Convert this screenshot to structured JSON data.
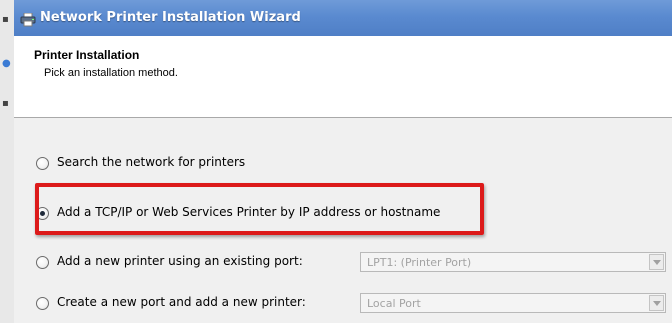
{
  "window": {
    "title": "Network Printer Installation Wizard",
    "icon": "printer-icon"
  },
  "header": {
    "title": "Printer Installation",
    "subtitle": "Pick an installation method."
  },
  "options": [
    {
      "label": "Search the network for printers",
      "selected": false
    },
    {
      "label": "Add a TCP/IP or Web Services Printer by IP address or hostname",
      "selected": true
    },
    {
      "label": "Add a new printer using an existing port:",
      "selected": false
    },
    {
      "label": "Create a new port and add a new printer:",
      "selected": false
    }
  ],
  "existing_port": {
    "value": "LPT1: (Printer Port)",
    "enabled": false
  },
  "new_port_type": {
    "value": "Local Port",
    "enabled": false
  },
  "colors": {
    "title_bar": "#5a8ad0",
    "highlight_box": "#dc1a1a",
    "dialog_body": "#f0f0f0"
  }
}
